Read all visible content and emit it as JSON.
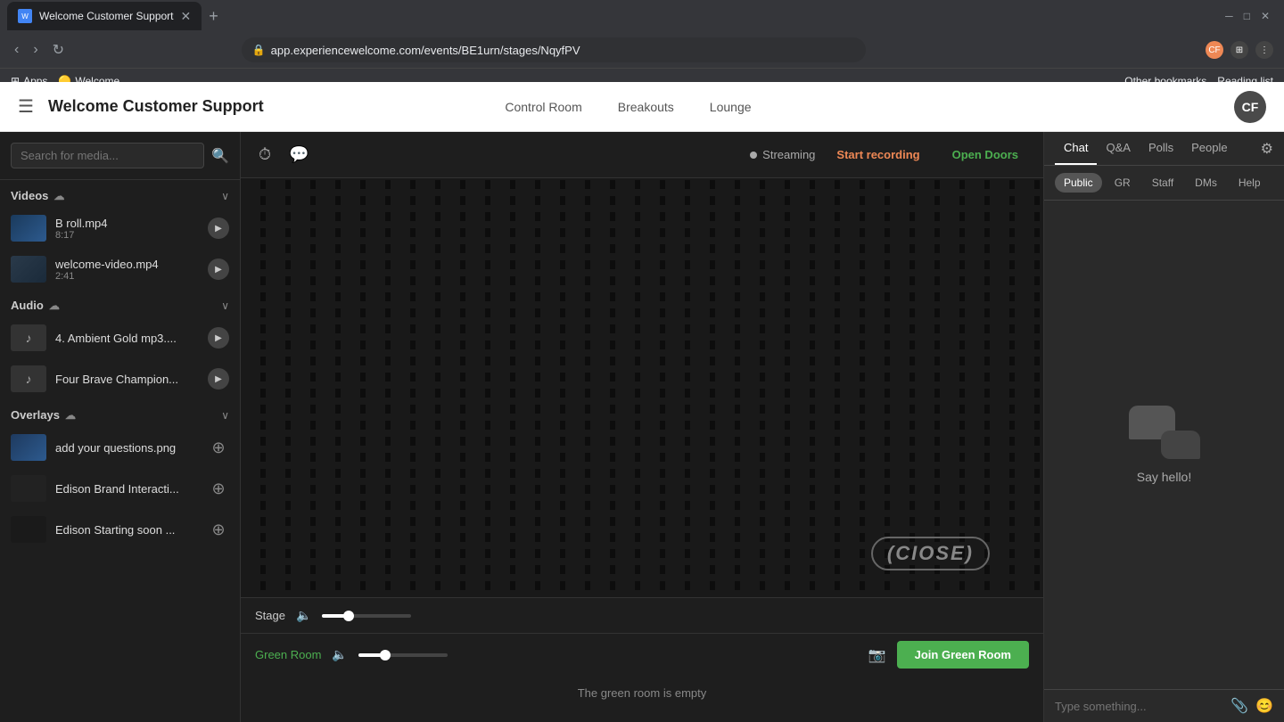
{
  "browser": {
    "tab_title": "Welcome Customer Support",
    "tab_favicon": "W",
    "url": "app.experiencewelcome.com/events/BE1urn/stages/NqyfPV",
    "bookmarks": [
      {
        "label": "Apps",
        "icon": "⊞"
      },
      {
        "label": "Welcome",
        "icon": "🟡"
      }
    ],
    "bookmark_other": "Other bookmarks",
    "bookmark_reading": "Reading list"
  },
  "app": {
    "header": {
      "title": "Welcome Customer Support",
      "nav": [
        {
          "label": "Control Room"
        },
        {
          "label": "Breakouts"
        },
        {
          "label": "Lounge"
        }
      ],
      "avatar_initials": "CF"
    }
  },
  "sidebar": {
    "search_placeholder": "Search for media...",
    "videos_section": "Videos",
    "audio_section": "Audio",
    "overlays_section": "Overlays",
    "videos": [
      {
        "name": "B roll.mp4",
        "duration": "8:17",
        "type": "video"
      },
      {
        "name": "welcome-video.mp4",
        "duration": "2:41",
        "type": "video"
      }
    ],
    "audio_items": [
      {
        "name": "4. Ambient Gold mp3....",
        "type": "audio"
      },
      {
        "name": "Four Brave Champion...",
        "type": "audio"
      }
    ],
    "overlays": [
      {
        "name": "add your questions.png",
        "type": "overlay"
      },
      {
        "name": "Edison Brand Interacti...",
        "type": "overlay"
      },
      {
        "name": "Edison Starting soon ...",
        "type": "overlay"
      }
    ]
  },
  "stage": {
    "streaming_label": "Streaming",
    "start_recording_label": "Start recording",
    "open_doors_label": "Open Doors",
    "stage_label": "Stage",
    "logo_text": "(CIOSE)",
    "volume_pct": 30
  },
  "green_room": {
    "label": "Green Room",
    "empty_text": "The green room is empty",
    "join_btn": "Join Green Room"
  },
  "chat_panel": {
    "tabs": [
      {
        "label": "Chat",
        "active": true
      },
      {
        "label": "Q&A",
        "active": false
      },
      {
        "label": "Polls",
        "active": false
      },
      {
        "label": "People",
        "active": false
      }
    ],
    "sub_tabs": [
      {
        "label": "Public",
        "active": true
      },
      {
        "label": "GR",
        "active": false
      },
      {
        "label": "Staff",
        "active": false
      },
      {
        "label": "DMs",
        "active": false
      },
      {
        "label": "Help",
        "active": false
      }
    ],
    "say_hello": "Say hello!",
    "input_placeholder": "Type something..."
  }
}
